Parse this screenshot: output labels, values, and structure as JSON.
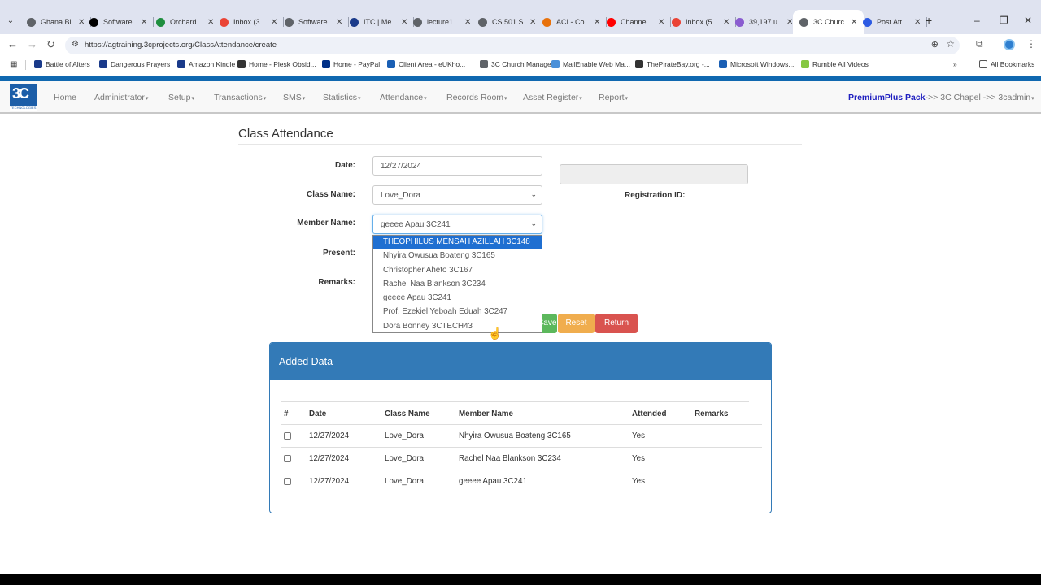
{
  "browser": {
    "tabs": [
      {
        "label": "Ghana Bi",
        "icon": "globe-icon",
        "color": "#5f6368"
      },
      {
        "label": "Software",
        "icon": "wikipedia-icon",
        "color": "#000000"
      },
      {
        "label": "Orchard",
        "icon": "orchard-icon",
        "color": "#1e8e3e"
      },
      {
        "label": "Inbox (3",
        "icon": "gmail-icon",
        "color": "#ea4335"
      },
      {
        "label": "Software",
        "icon": "globe-icon",
        "color": "#5f6368"
      },
      {
        "label": "ITC | Me",
        "icon": "itc-icon",
        "color": "#1a3a8a"
      },
      {
        "label": "lecture1",
        "icon": "globe-icon",
        "color": "#5f6368"
      },
      {
        "label": "CS 501 S",
        "icon": "globe-icon",
        "color": "#5f6368"
      },
      {
        "label": "ACI - Co",
        "icon": "aci-icon",
        "color": "#e8710a"
      },
      {
        "label": "Channel",
        "icon": "youtube-icon",
        "color": "#ff0000"
      },
      {
        "label": "Inbox (5",
        "icon": "gmail-icon",
        "color": "#ea4335"
      },
      {
        "label": "39,197 u",
        "icon": "mail-icon",
        "color": "#8a5cd0"
      },
      {
        "label": "3C Churc",
        "icon": "globe-icon",
        "color": "#5f6368",
        "active": true
      },
      {
        "label": "Post Att",
        "icon": "zoom-icon",
        "color": "#2d5be3"
      }
    ],
    "url": "https://agtraining.3cprojects.org/ClassAttendance/create",
    "bookmarks": [
      {
        "label": "Battle of Alters",
        "color": "#1a3a8a"
      },
      {
        "label": "Dangerous Prayers",
        "color": "#1a3a8a"
      },
      {
        "label": "Amazon Kindle",
        "color": "#1a3a8a"
      },
      {
        "label": "Home - Plesk Obsid...",
        "color": "#333333"
      },
      {
        "label": "Home - PayPal",
        "color": "#003087"
      },
      {
        "label": "Client Area - eUKho...",
        "color": "#1a5fb4"
      },
      {
        "label": "3C Church Manager...",
        "color": "#5f6368"
      },
      {
        "label": "MailEnable Web Ma...",
        "color": "#4a90d9"
      },
      {
        "label": "ThePirateBay.org -...",
        "color": "#333333"
      },
      {
        "label": "Microsoft Windows...",
        "color": "#1a5fb4"
      },
      {
        "label": "Rumble All Videos",
        "color": "#85c742"
      }
    ],
    "all_bookmarks": "All Bookmarks",
    "more_bookmarks": "»"
  },
  "site": {
    "logo_sub": "TECHNOLOGIES",
    "nav": [
      {
        "label": "Home",
        "dropdown": false
      },
      {
        "label": "Administrator",
        "dropdown": true
      },
      {
        "label": "Setup",
        "dropdown": true
      },
      {
        "label": "Transactions",
        "dropdown": true
      },
      {
        "label": "SMS",
        "dropdown": true
      },
      {
        "label": "Statistics",
        "dropdown": true
      },
      {
        "label": "Attendance",
        "dropdown": true
      },
      {
        "label": "Records Room",
        "dropdown": true
      },
      {
        "label": "Asset Register",
        "dropdown": true
      },
      {
        "label": "Report",
        "dropdown": true
      }
    ],
    "account": {
      "pack": "PremiumPlus Pack",
      "path": "->> 3C Chapel ->> 3cadmin"
    },
    "brand_color": "#1068b0"
  },
  "form": {
    "title": "Class Attendance",
    "date_label": "Date:",
    "date_value": "12/27/2024",
    "class_label": "Class Name:",
    "class_value": "Love_Dora",
    "member_label": "Member Name:",
    "member_value": "geeee Apau 3C241",
    "present_label": "Present:",
    "remarks_label": "Remarks:",
    "registration_label": "Registration ID:",
    "registration_value": "",
    "member_options": [
      "THEOPHILUS MENSAH AZILLAH 3C148",
      "Nhyira Owusua Boateng 3C165",
      "Christopher Aheto 3C167",
      "Rachel Naa Blankson 3C234",
      "geeee Apau 3C241",
      "Prof. Ezekiel Yeboah Eduah 3C247",
      "Dora Bonney 3CTECH43"
    ],
    "highlighted_option": "THEOPHILUS MENSAH AZILLAH 3C148",
    "buttons": {
      "save": "Save",
      "reset": "Reset",
      "return": "Return"
    }
  },
  "added_data": {
    "title": "Added Data",
    "columns": [
      "#",
      "Date",
      "Class Name",
      "Member Name",
      "Attended",
      "Remarks"
    ],
    "rows": [
      {
        "checked": false,
        "date": "12/27/2024",
        "class_name": "Love_Dora",
        "member_name": "Nhyira Owusua Boateng 3C165",
        "attended": "Yes",
        "remarks": ""
      },
      {
        "checked": false,
        "date": "12/27/2024",
        "class_name": "Love_Dora",
        "member_name": "Rachel Naa Blankson 3C234",
        "attended": "Yes",
        "remarks": ""
      },
      {
        "checked": false,
        "date": "12/27/2024",
        "class_name": "Love_Dora",
        "member_name": "geeee Apau 3C241",
        "attended": "Yes",
        "remarks": ""
      }
    ]
  }
}
